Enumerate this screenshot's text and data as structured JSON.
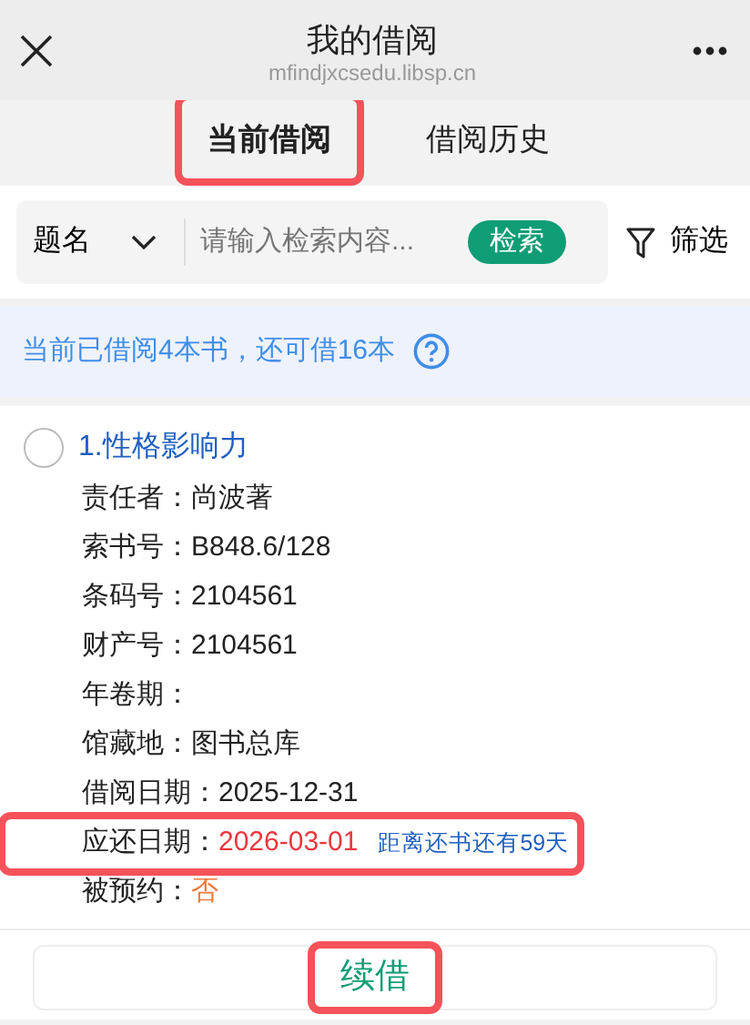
{
  "header": {
    "title": "我的借阅",
    "url": "mfindjxcsedu.libsp.cn"
  },
  "tabs": [
    {
      "label": "当前借阅",
      "selected": true,
      "highlighted": true
    },
    {
      "label": "借阅历史",
      "selected": false,
      "highlighted": false
    }
  ],
  "search": {
    "field": "题名",
    "placeholder": "请输入检索内容...",
    "button": "检索",
    "filter": "筛选"
  },
  "notice": "当前已借阅4本书，还可借16本",
  "book": {
    "title": "1.性格影响力",
    "checked": false,
    "fields": [
      {
        "label": "责任者：",
        "value": "尚波著"
      },
      {
        "label": "索书号：",
        "value": "B848.6/128"
      },
      {
        "label": "条码号：",
        "value": "2104561"
      },
      {
        "label": "财产号：",
        "value": "2104561"
      },
      {
        "label": "年卷期："
      },
      {
        "label": "馆藏地：",
        "value": "图书总库"
      },
      {
        "label": "借阅日期：",
        "value": "2025-12-31"
      },
      {
        "label": "应还日期：",
        "value": "2026-03-01",
        "color": "#e8383d",
        "note": "距离还书还有59天",
        "highlighted": true
      },
      {
        "label": "被预约：",
        "value": "否",
        "color": "#ef7a3a"
      }
    ],
    "action": {
      "label": "续借",
      "highlighted": true
    }
  }
}
